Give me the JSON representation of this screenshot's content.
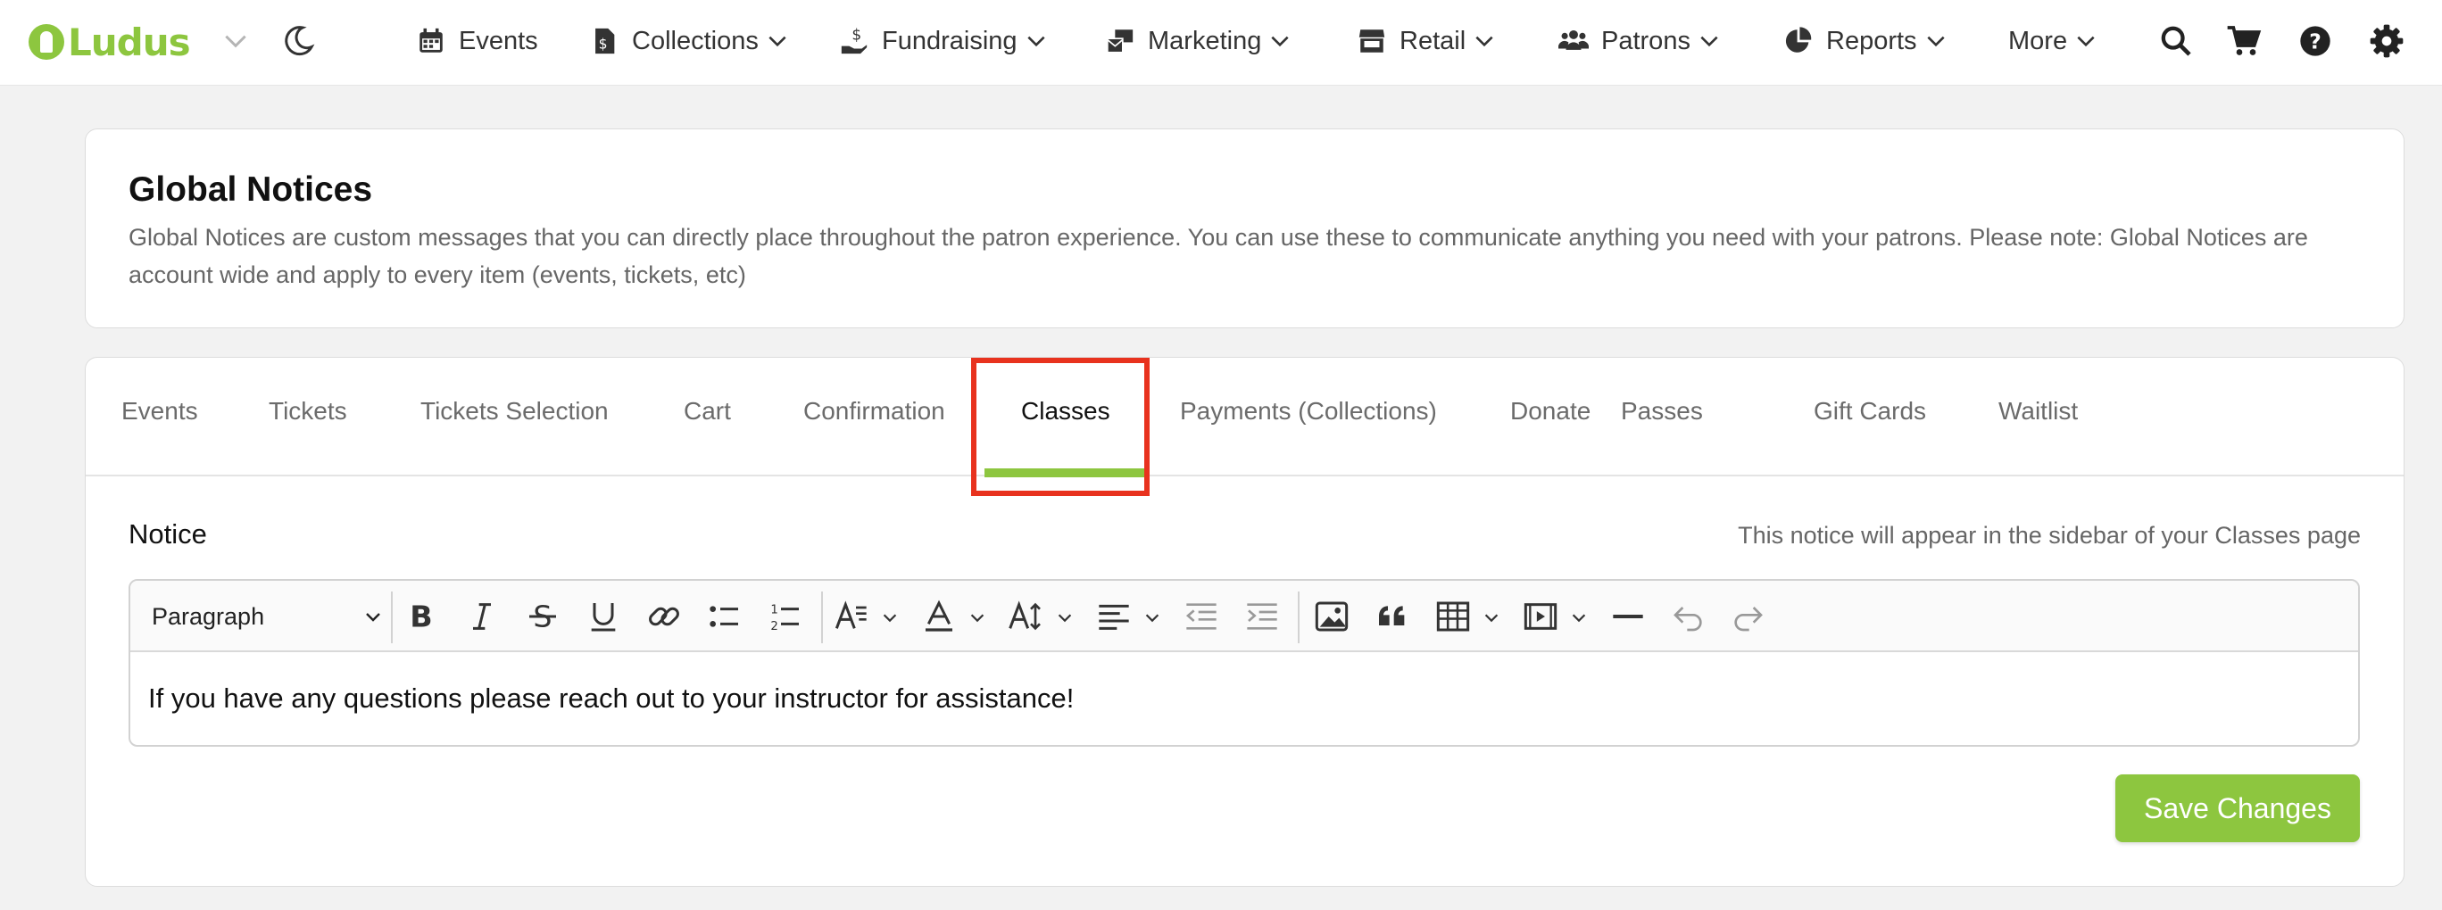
{
  "brand": {
    "name": "Ludus",
    "accent_color": "#8dc63f"
  },
  "nav": [
    {
      "label": "Events",
      "icon": "calendar-icon",
      "has_dropdown": false
    },
    {
      "label": "Collections",
      "icon": "receipt-icon",
      "has_dropdown": true
    },
    {
      "label": "Fundraising",
      "icon": "hand-dollar-icon",
      "has_dropdown": true
    },
    {
      "label": "Marketing",
      "icon": "mail-bulk-icon",
      "has_dropdown": true
    },
    {
      "label": "Retail",
      "icon": "store-icon",
      "has_dropdown": true
    },
    {
      "label": "Patrons",
      "icon": "users-icon",
      "has_dropdown": true
    },
    {
      "label": "Reports",
      "icon": "pie-chart-icon",
      "has_dropdown": true
    },
    {
      "label": "More",
      "icon": "",
      "has_dropdown": true
    }
  ],
  "tools": [
    "search-icon",
    "cart-icon",
    "help-icon",
    "gear-icon"
  ],
  "header": {
    "title": "Global Notices",
    "description": "Global Notices are custom messages that you can directly place throughout the patron experience. You can use these to communicate anything you need with your patrons. Please note: Global Notices are account wide and apply to every item (events, tickets, etc)"
  },
  "tabs": [
    {
      "label": "Events",
      "active": false
    },
    {
      "label": "Tickets",
      "active": false
    },
    {
      "label": "Tickets Selection",
      "active": false
    },
    {
      "label": "Cart",
      "active": false
    },
    {
      "label": "Confirmation",
      "active": false
    },
    {
      "label": "Classes",
      "active": true
    },
    {
      "label": "Payments (Collections)",
      "active": false
    },
    {
      "label": "Donate",
      "active": false
    },
    {
      "label": "Passes",
      "active": false
    },
    {
      "label": "Gift Cards",
      "active": false
    },
    {
      "label": "Waitlist",
      "active": false
    }
  ],
  "notice": {
    "label": "Notice",
    "hint": "This notice will appear in the sidebar of your Classes page",
    "block_format": "Paragraph",
    "content": "If you have any questions please reach out to your instructor for assistance!"
  },
  "toolbar_icons": [
    "bold-icon",
    "italic-icon",
    "strikethrough-icon",
    "underline-icon",
    "link-icon",
    "bulleted-list-icon",
    "numbered-list-icon",
    "font-family-icon",
    "font-color-icon",
    "font-size-icon",
    "align-icon",
    "outdent-icon",
    "indent-icon",
    "image-icon",
    "blockquote-icon",
    "table-icon",
    "media-icon",
    "horizontal-line-icon",
    "undo-icon",
    "redo-icon"
  ],
  "save_label": "Save Changes",
  "highlight_color": "#e8321e"
}
